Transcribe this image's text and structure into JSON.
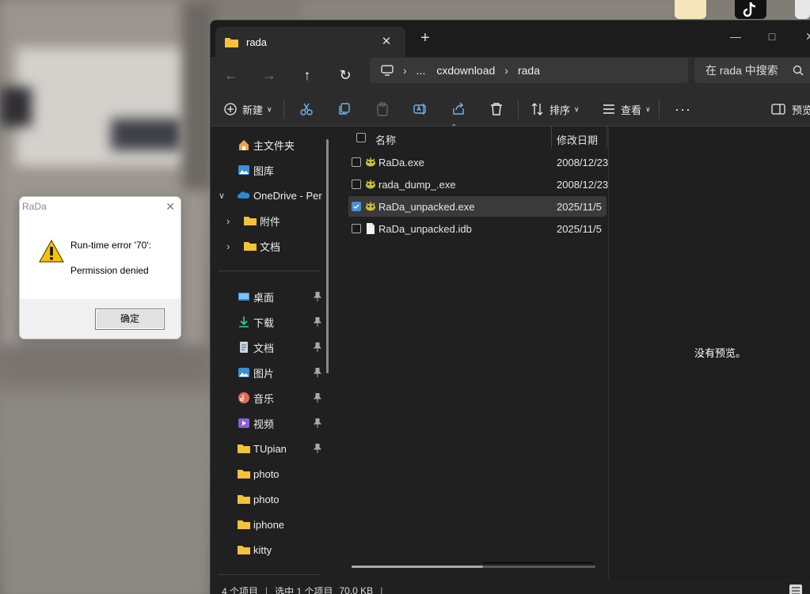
{
  "explorer": {
    "tab_title": "rada",
    "address_parts": [
      "...",
      "cxdownload",
      "rada"
    ],
    "search_placeholder": "在 rada 中搜索",
    "commands": {
      "new": "新建",
      "sort": "排序",
      "view": "查看",
      "preview": "预览"
    },
    "nav": {
      "home": "主文件夹",
      "gallery": "图库",
      "onedrive": "OneDrive - Per",
      "onedrive_children": [
        "附件",
        "文档"
      ],
      "quick_access": [
        {
          "label": "桌面",
          "icon": "desktop-icon",
          "pinned": true
        },
        {
          "label": "下载",
          "icon": "download-icon",
          "pinned": true
        },
        {
          "label": "文档",
          "icon": "document-icon",
          "pinned": true
        },
        {
          "label": "图片",
          "icon": "pictures-icon",
          "pinned": true
        },
        {
          "label": "音乐",
          "icon": "music-icon",
          "pinned": true
        },
        {
          "label": "视频",
          "icon": "video-icon",
          "pinned": true
        },
        {
          "label": "TUpian",
          "icon": "folder-icon",
          "pinned": true
        },
        {
          "label": "photo",
          "icon": "folder-icon",
          "pinned": false
        },
        {
          "label": "photo",
          "icon": "folder-icon",
          "pinned": false
        },
        {
          "label": "iphone",
          "icon": "folder-icon",
          "pinned": false
        },
        {
          "label": "kitty",
          "icon": "folder-icon",
          "pinned": false
        }
      ]
    },
    "columns": {
      "name": "名称",
      "modified": "修改日期"
    },
    "files": [
      {
        "name": "RaDa.exe",
        "date": "2008/12/23",
        "type": "exe",
        "selected": false
      },
      {
        "name": "rada_dump_.exe",
        "date": "2008/12/23",
        "type": "exe",
        "selected": false
      },
      {
        "name": "RaDa_unpacked.exe",
        "date": "2025/11/5",
        "type": "exe",
        "selected": true
      },
      {
        "name": "RaDa_unpacked.idb",
        "date": "2025/11/5",
        "type": "file",
        "selected": false
      }
    ],
    "preview_text": "没有预览。",
    "status": {
      "count": "4 个项目",
      "selected": "选中 1 个项目",
      "size": "70.0 KB"
    }
  },
  "dialog": {
    "title": "RaDa",
    "line1": "Run-time error '70':",
    "line2": "Permission denied",
    "ok_label": "确定",
    "icon": "warning-icon"
  },
  "colors": {
    "accent": "#4c8dd6",
    "folder": "#f3c13a",
    "window_bg": "#202020"
  }
}
